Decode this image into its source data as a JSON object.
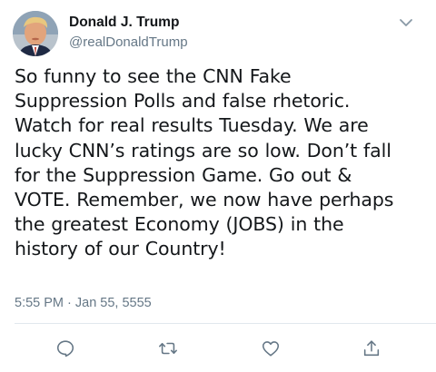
{
  "tweet": {
    "author": {
      "display_name": "Donald J. Trump",
      "handle": "@realDonaldTrump",
      "avatar_icon": "profile-photo"
    },
    "text_lines": [
      "So funny to see the CNN Fake",
      "Suppression Polls and false rhetoric.",
      "Watch for real results Tuesday. We are",
      "lucky CNN’s ratings are so low. Don’t fall",
      "for the Suppression Game. Go out &",
      "VOTE. Remember, we now have perhaps",
      "the greatest Economy (JOBS) in the",
      "history of our Country!"
    ],
    "timestamp": "5:55 PM · Jan 55, 5555",
    "actions": [
      {
        "icon": "reply-icon"
      },
      {
        "icon": "retweet-icon"
      },
      {
        "icon": "like-icon"
      },
      {
        "icon": "share-icon"
      }
    ],
    "menu_icon": "chevron-down-icon"
  },
  "colors": {
    "text": "#14171a",
    "secondary": "#657786",
    "divider": "#e1e8ed"
  }
}
